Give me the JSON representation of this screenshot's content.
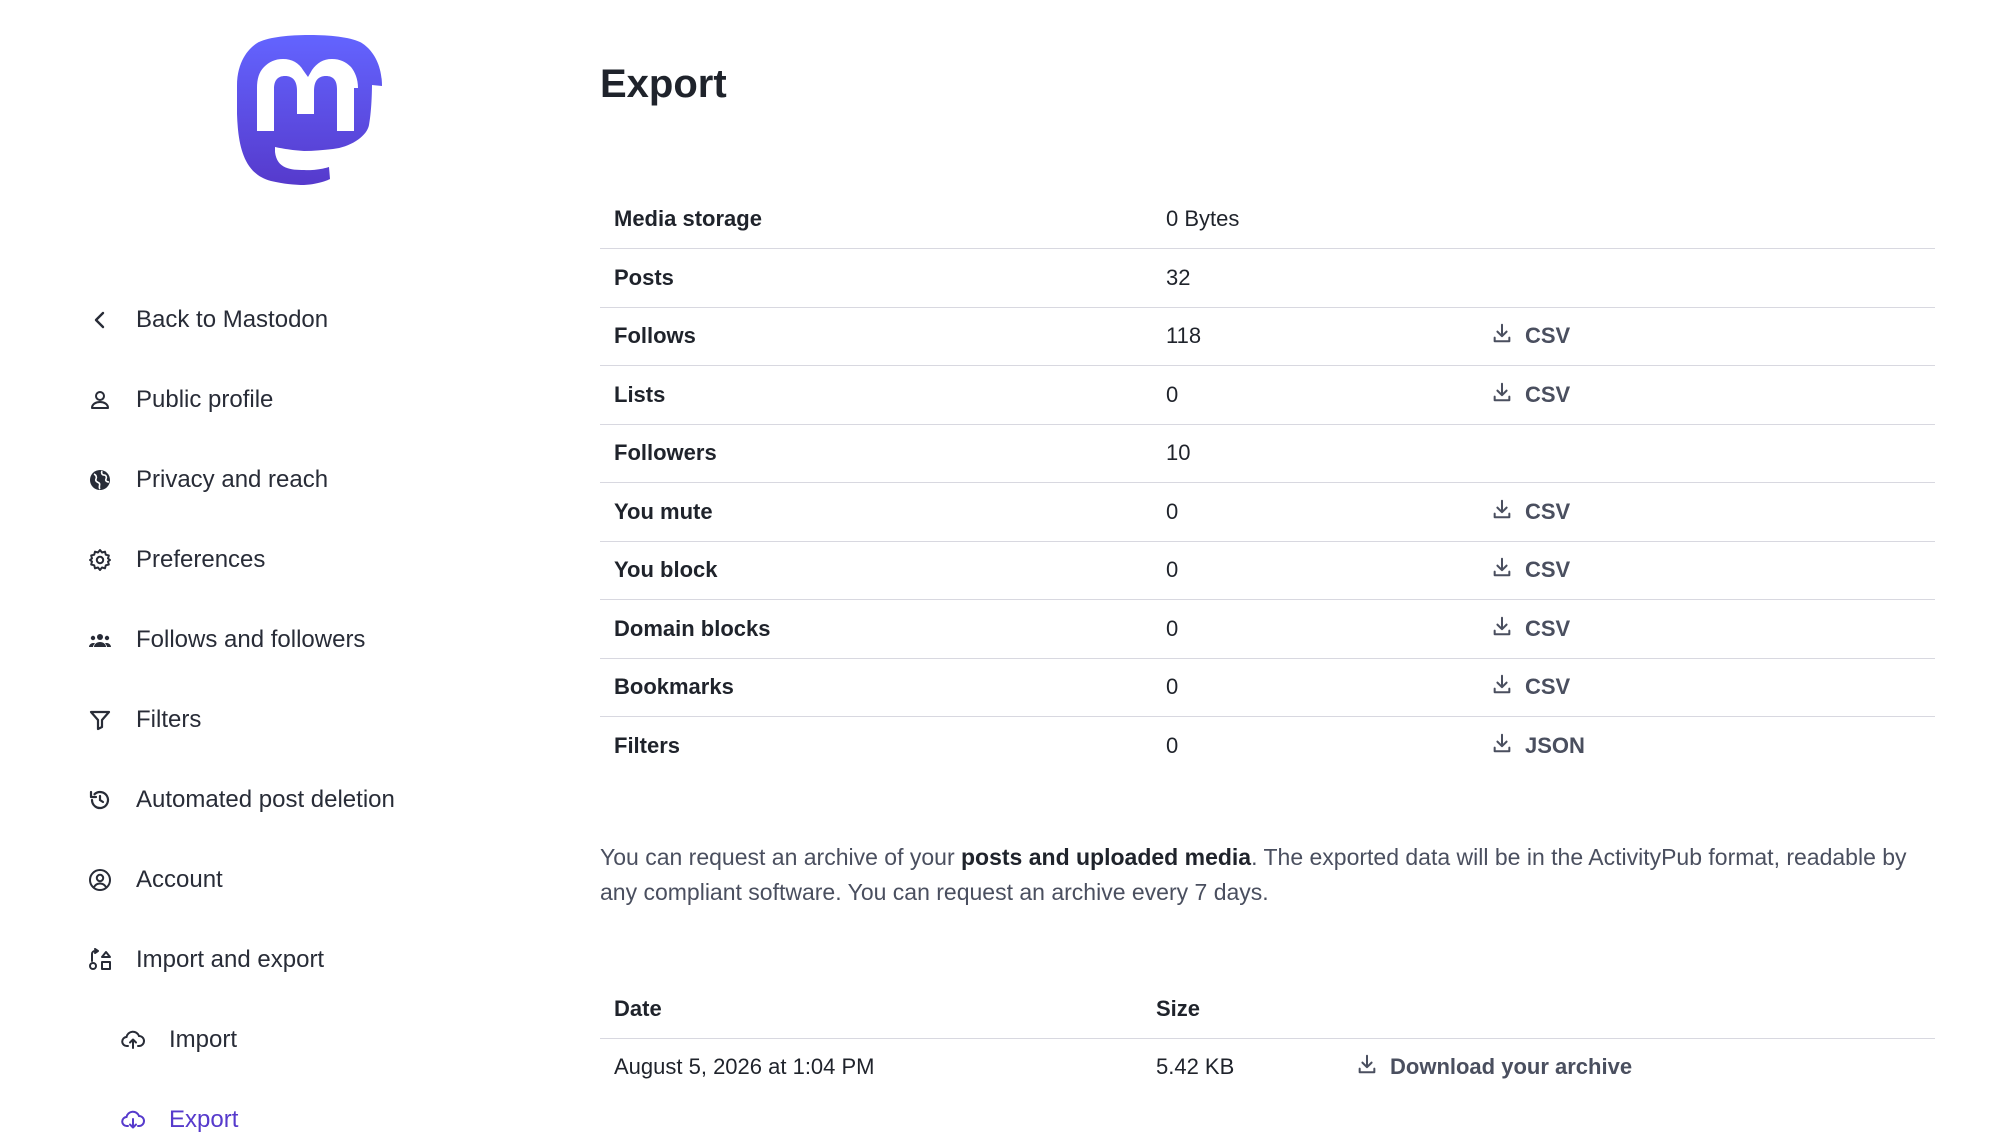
{
  "brand": {
    "logo_icon": "mastodon-logo-icon",
    "accent": "#563acc"
  },
  "sidebar": {
    "items": [
      {
        "label": "Back to Mastodon",
        "icon": "chevron-left-icon"
      },
      {
        "label": "Public profile",
        "icon": "person-icon"
      },
      {
        "label": "Privacy and reach",
        "icon": "globe-icon"
      },
      {
        "label": "Preferences",
        "icon": "gear-icon"
      },
      {
        "label": "Follows and followers",
        "icon": "group-icon"
      },
      {
        "label": "Filters",
        "icon": "filter-icon"
      },
      {
        "label": "Automated post deletion",
        "icon": "history-icon"
      },
      {
        "label": "Account",
        "icon": "account-circle-icon"
      },
      {
        "label": "Import and export",
        "icon": "import-export-icon"
      },
      {
        "label": "Import",
        "icon": "cloud-upload-icon"
      },
      {
        "label": "Export",
        "icon": "cloud-download-icon"
      }
    ]
  },
  "main": {
    "title": "Export",
    "stats": [
      {
        "label": "Media storage",
        "value": "0 Bytes",
        "download": ""
      },
      {
        "label": "Posts",
        "value": "32",
        "download": ""
      },
      {
        "label": "Follows",
        "value": "118",
        "download": "CSV"
      },
      {
        "label": "Lists",
        "value": "0",
        "download": "CSV"
      },
      {
        "label": "Followers",
        "value": "10",
        "download": ""
      },
      {
        "label": "You mute",
        "value": "0",
        "download": "CSV"
      },
      {
        "label": "You block",
        "value": "0",
        "download": "CSV"
      },
      {
        "label": "Domain blocks",
        "value": "0",
        "download": "CSV"
      },
      {
        "label": "Bookmarks",
        "value": "0",
        "download": "CSV"
      },
      {
        "label": "Filters",
        "value": "0",
        "download": "JSON"
      }
    ],
    "archive_text": {
      "before": "You can request an archive of your ",
      "bold": "posts and uploaded media",
      "after": ". The exported data will be in the ActivityPub format, readable by any compliant software. You can request an archive every 7 days."
    },
    "archives": {
      "headers": {
        "date": "Date",
        "size": "Size"
      },
      "rows": [
        {
          "date": "August 5, 2026 at 1:04 PM",
          "size": "5.42 KB",
          "link": "Download your archive"
        }
      ]
    }
  }
}
